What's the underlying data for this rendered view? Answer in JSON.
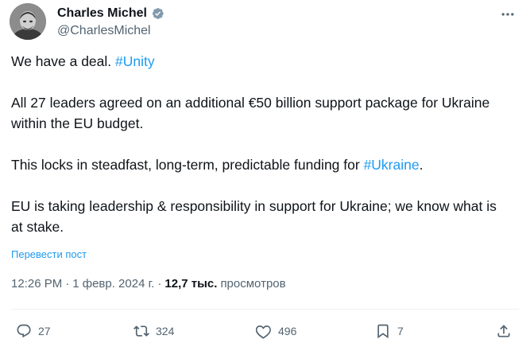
{
  "author": {
    "display_name": "Charles Michel",
    "handle": "@CharlesMichel",
    "verified": true,
    "avatar": "user-avatar"
  },
  "post": {
    "p1_text": "We have a deal. ",
    "p1_hashtag": "#Unity",
    "p2_text": "All 27 leaders agreed on an additional €50 billion support package for Ukraine within the EU budget.",
    "p3_text": "This locks in steadfast, long-term, predictable funding for ",
    "p3_hashtag": "#Ukraine",
    "p3_end": ".",
    "p4_text": "EU is taking leadership & responsibility in support for Ukraine; we know what is at stake."
  },
  "translate_label": "Перевести пост",
  "meta": {
    "time": "12:26 PM",
    "sep1": "·",
    "date": "1 февр. 2024 г.",
    "sep2": "·",
    "views_count": "12,7 тыс.",
    "views_label": "просмотров"
  },
  "actions": {
    "replies": "27",
    "reposts": "324",
    "likes": "496",
    "bookmarks": "7"
  },
  "colors": {
    "accent": "#1d9bf0",
    "text": "#0f1419",
    "secondary": "#536471"
  }
}
